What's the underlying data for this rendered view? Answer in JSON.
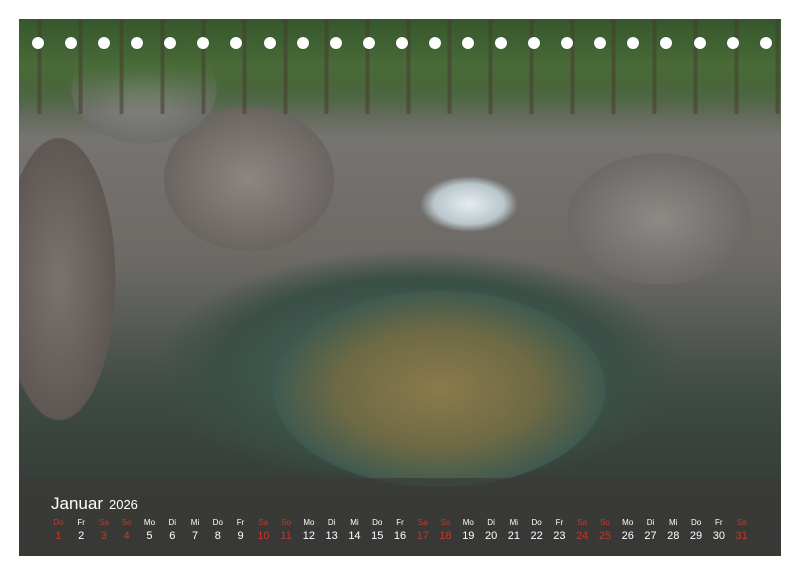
{
  "calendar": {
    "month": "Januar",
    "year": "2026",
    "weekend_color": "#c0392b",
    "days": [
      {
        "dow": "Do",
        "num": "1",
        "weekend": true
      },
      {
        "dow": "Fr",
        "num": "2",
        "weekend": false
      },
      {
        "dow": "Sa",
        "num": "3",
        "weekend": true
      },
      {
        "dow": "So",
        "num": "4",
        "weekend": true
      },
      {
        "dow": "Mo",
        "num": "5",
        "weekend": false
      },
      {
        "dow": "Di",
        "num": "6",
        "weekend": false
      },
      {
        "dow": "Mi",
        "num": "7",
        "weekend": false
      },
      {
        "dow": "Do",
        "num": "8",
        "weekend": false
      },
      {
        "dow": "Fr",
        "num": "9",
        "weekend": false
      },
      {
        "dow": "Sa",
        "num": "10",
        "weekend": true
      },
      {
        "dow": "So",
        "num": "11",
        "weekend": true
      },
      {
        "dow": "Mo",
        "num": "12",
        "weekend": false
      },
      {
        "dow": "Di",
        "num": "13",
        "weekend": false
      },
      {
        "dow": "Mi",
        "num": "14",
        "weekend": false
      },
      {
        "dow": "Do",
        "num": "15",
        "weekend": false
      },
      {
        "dow": "Fr",
        "num": "16",
        "weekend": false
      },
      {
        "dow": "Sa",
        "num": "17",
        "weekend": true
      },
      {
        "dow": "So",
        "num": "18",
        "weekend": true
      },
      {
        "dow": "Mo",
        "num": "19",
        "weekend": false
      },
      {
        "dow": "Di",
        "num": "20",
        "weekend": false
      },
      {
        "dow": "Mi",
        "num": "21",
        "weekend": false
      },
      {
        "dow": "Do",
        "num": "22",
        "weekend": false
      },
      {
        "dow": "Fr",
        "num": "23",
        "weekend": false
      },
      {
        "dow": "Sa",
        "num": "24",
        "weekend": true
      },
      {
        "dow": "So",
        "num": "25",
        "weekend": true
      },
      {
        "dow": "Mo",
        "num": "26",
        "weekend": false
      },
      {
        "dow": "Di",
        "num": "27",
        "weekend": false
      },
      {
        "dow": "Mi",
        "num": "28",
        "weekend": false
      },
      {
        "dow": "Do",
        "num": "29",
        "weekend": false
      },
      {
        "dow": "Fr",
        "num": "30",
        "weekend": false
      },
      {
        "dow": "Sa",
        "num": "31",
        "weekend": true
      }
    ]
  }
}
